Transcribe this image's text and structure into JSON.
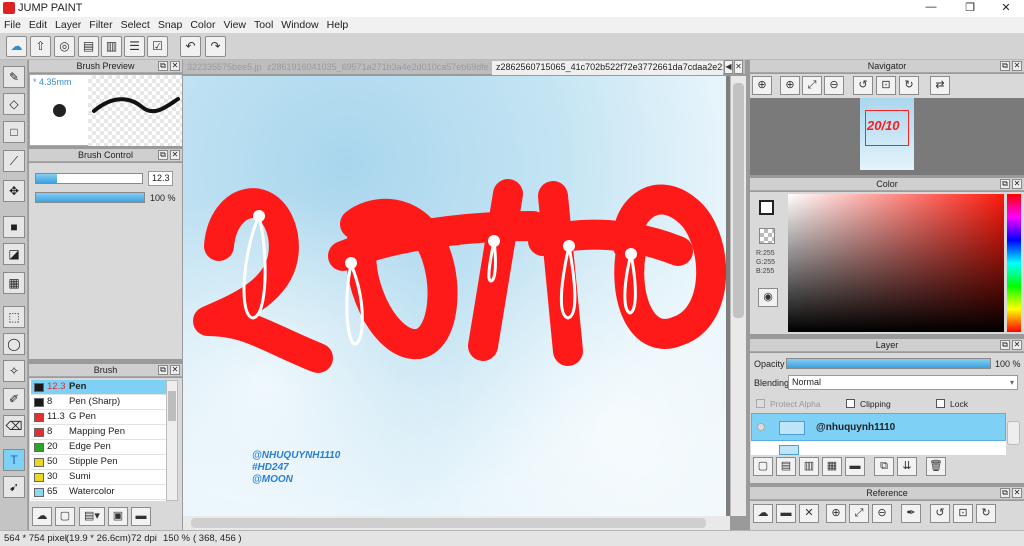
{
  "app": {
    "title": "JUMP PAINT",
    "minimize": "—",
    "maximize": "❐",
    "close": "✕"
  },
  "menu": [
    "File",
    "Edit",
    "Layer",
    "Filter",
    "Select",
    "Snap",
    "Color",
    "View",
    "Tool",
    "Window",
    "Help"
  ],
  "tabs": [
    {
      "label": "322335575bee5.jpg",
      "active": false
    },
    {
      "label": "z2861916041035_69571a271b3a4e2d010ca57eb69dfe7f.jpg",
      "active": false
    },
    {
      "label": "z2862560715065_41c702b522f72e3772661da7cdaa2e22.jpg",
      "active": true
    }
  ],
  "panels": {
    "brush_preview": {
      "title": "Brush Preview",
      "size": "* 4.35mm"
    },
    "brush_control": {
      "title": "Brush Control",
      "size_value": "12.3",
      "opacity_value": "100 %",
      "size_fraction": 0.2,
      "opacity_fraction": 1.0
    },
    "brush": {
      "title": "Brush",
      "items": [
        {
          "size": "12.3",
          "name": "Pen",
          "color": "#1a1a1a",
          "selected": true
        },
        {
          "size": "8",
          "name": "Pen (Sharp)",
          "color": "#1a1a1a",
          "selected": false
        },
        {
          "size": "11.3",
          "name": "G Pen",
          "color": "#e03030",
          "selected": false
        },
        {
          "size": "8",
          "name": "Mapping Pen",
          "color": "#e03030",
          "selected": false
        },
        {
          "size": "20",
          "name": "Edge Pen",
          "color": "#2aa52a",
          "selected": false
        },
        {
          "size": "50",
          "name": "Stipple Pen",
          "color": "#e8d81e",
          "selected": false
        },
        {
          "size": "30",
          "name": "Sumi",
          "color": "#e8d81e",
          "selected": false
        },
        {
          "size": "65",
          "name": "Watercolor",
          "color": "#8fd6f0",
          "selected": false
        }
      ]
    },
    "navigator": {
      "title": "Navigator"
    },
    "color": {
      "title": "Color",
      "r": "R:255",
      "g": "G:255",
      "b": "B:255",
      "primary": "#ffffff",
      "secondary": "#e12020"
    },
    "layer": {
      "title": "Layer",
      "opacity_label": "Opacity",
      "opacity_value": "100 %",
      "opacity_fraction": 1.0,
      "blending_label": "Blending",
      "blending_value": "Normal",
      "protect_alpha": "Protect Alpha",
      "clipping": "Clipping",
      "lock": "Lock",
      "layers": [
        {
          "name": "@nhuquynh1110",
          "selected": true
        }
      ]
    },
    "reference": {
      "title": "Reference"
    }
  },
  "artwork": {
    "main_text": "20/10",
    "credit_lines": [
      "@NHUQUYNH1110",
      "#HD247",
      "@MOON"
    ],
    "text_color": "#ff1a1a",
    "credit_color": "#2a7fd4"
  },
  "status": {
    "size": "564 * 754 pixel",
    "cm": "(19.9 * 26.6cm)",
    "dpi": "72 dpi",
    "zoom": "150 %",
    "coords": "( 368, 456 )"
  },
  "colors": {
    "accent": "#3aa3e3",
    "selection": "#7fd0f5"
  }
}
